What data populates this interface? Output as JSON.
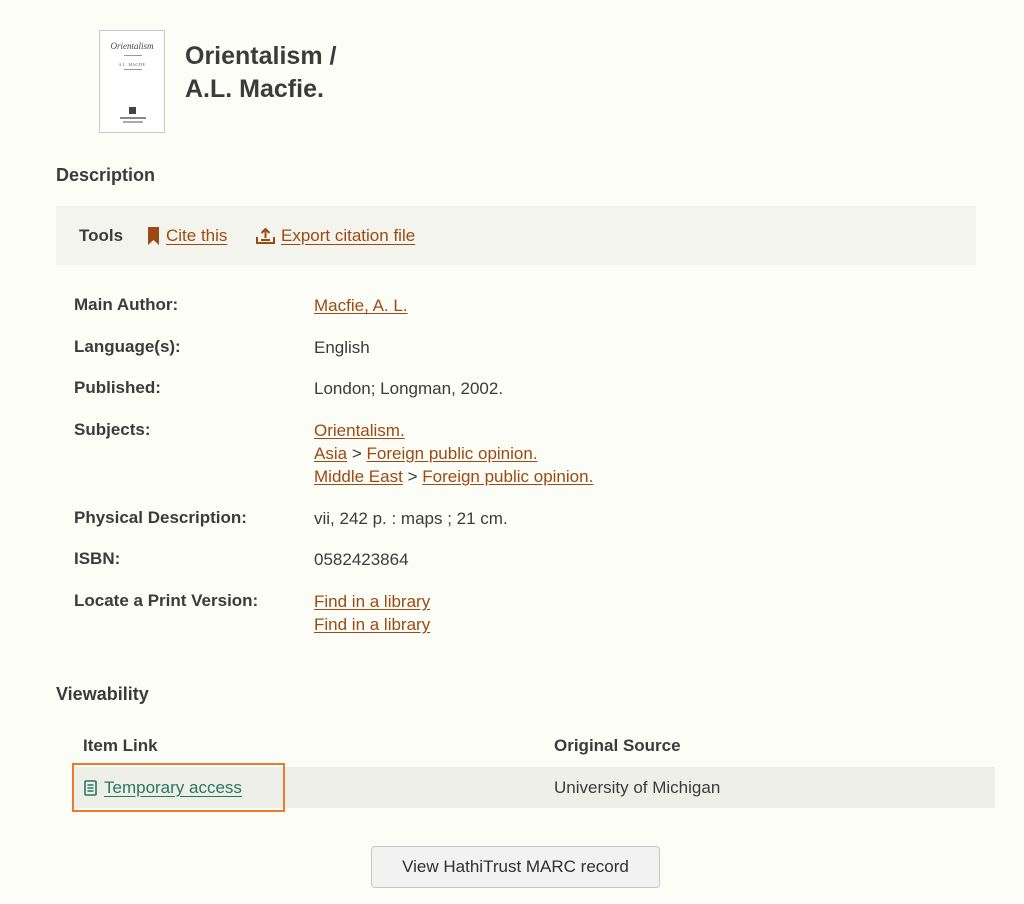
{
  "record": {
    "cover": {
      "title_text": "Orientalism",
      "author_text": "A.L. MACFIE"
    },
    "title_line1": "Orientalism /",
    "title_line2": "A.L. Macfie."
  },
  "description": {
    "heading": "Description",
    "tools": {
      "label": "Tools",
      "cite_label": "Cite this",
      "export_label": "Export citation file"
    },
    "fields": {
      "main_author": {
        "label": "Main Author:",
        "value": "Macfie, A. L."
      },
      "language": {
        "label": "Language(s):",
        "value": "English"
      },
      "published": {
        "label": "Published:",
        "value": "London; Longman, 2002."
      },
      "subjects": {
        "label": "Subjects:",
        "line1": {
          "a": "Orientalism."
        },
        "line2": {
          "a": "Asia",
          "sep": ">",
          "b": "Foreign public opinion."
        },
        "line3": {
          "a": "Middle East",
          "sep": ">",
          "b": "Foreign public opinion."
        }
      },
      "physical": {
        "label": "Physical Description:",
        "value": "vii, 242 p. : maps ; 21 cm."
      },
      "isbn": {
        "label": "ISBN:",
        "value": "0582423864"
      },
      "locate": {
        "label": "Locate a Print Version:",
        "link1": "Find in a library",
        "link2": "Find in a library"
      }
    }
  },
  "viewability": {
    "heading": "Viewability",
    "col_item_link": "Item Link",
    "col_original_source": "Original Source",
    "row": {
      "item_link": "Temporary access",
      "source": "University of Michigan"
    }
  },
  "marc_button": "View HathiTrust MARC record",
  "colors": {
    "link": "#9c4a12",
    "access_link": "#2b7561",
    "highlight": "#e97a2e",
    "background": "#fdfdf8"
  },
  "icons": {
    "cite": "bookmark-icon",
    "export": "export-icon",
    "access": "document-icon"
  }
}
